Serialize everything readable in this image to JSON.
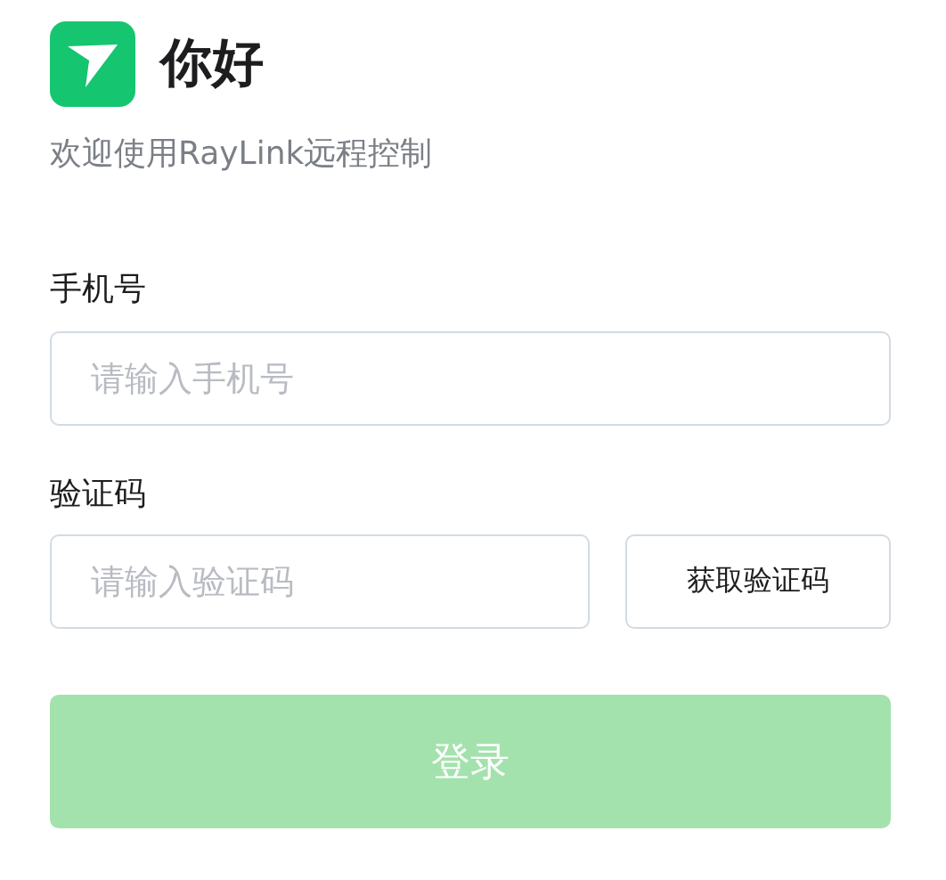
{
  "header": {
    "title": "你好",
    "subtitle": "欢迎使用RayLink远程控制"
  },
  "phone": {
    "label": "手机号",
    "placeholder": "请输入手机号"
  },
  "code": {
    "label": "验证码",
    "placeholder": "请输入验证码",
    "button": "获取验证码"
  },
  "login": {
    "label": "登录",
    "disabled": true
  }
}
